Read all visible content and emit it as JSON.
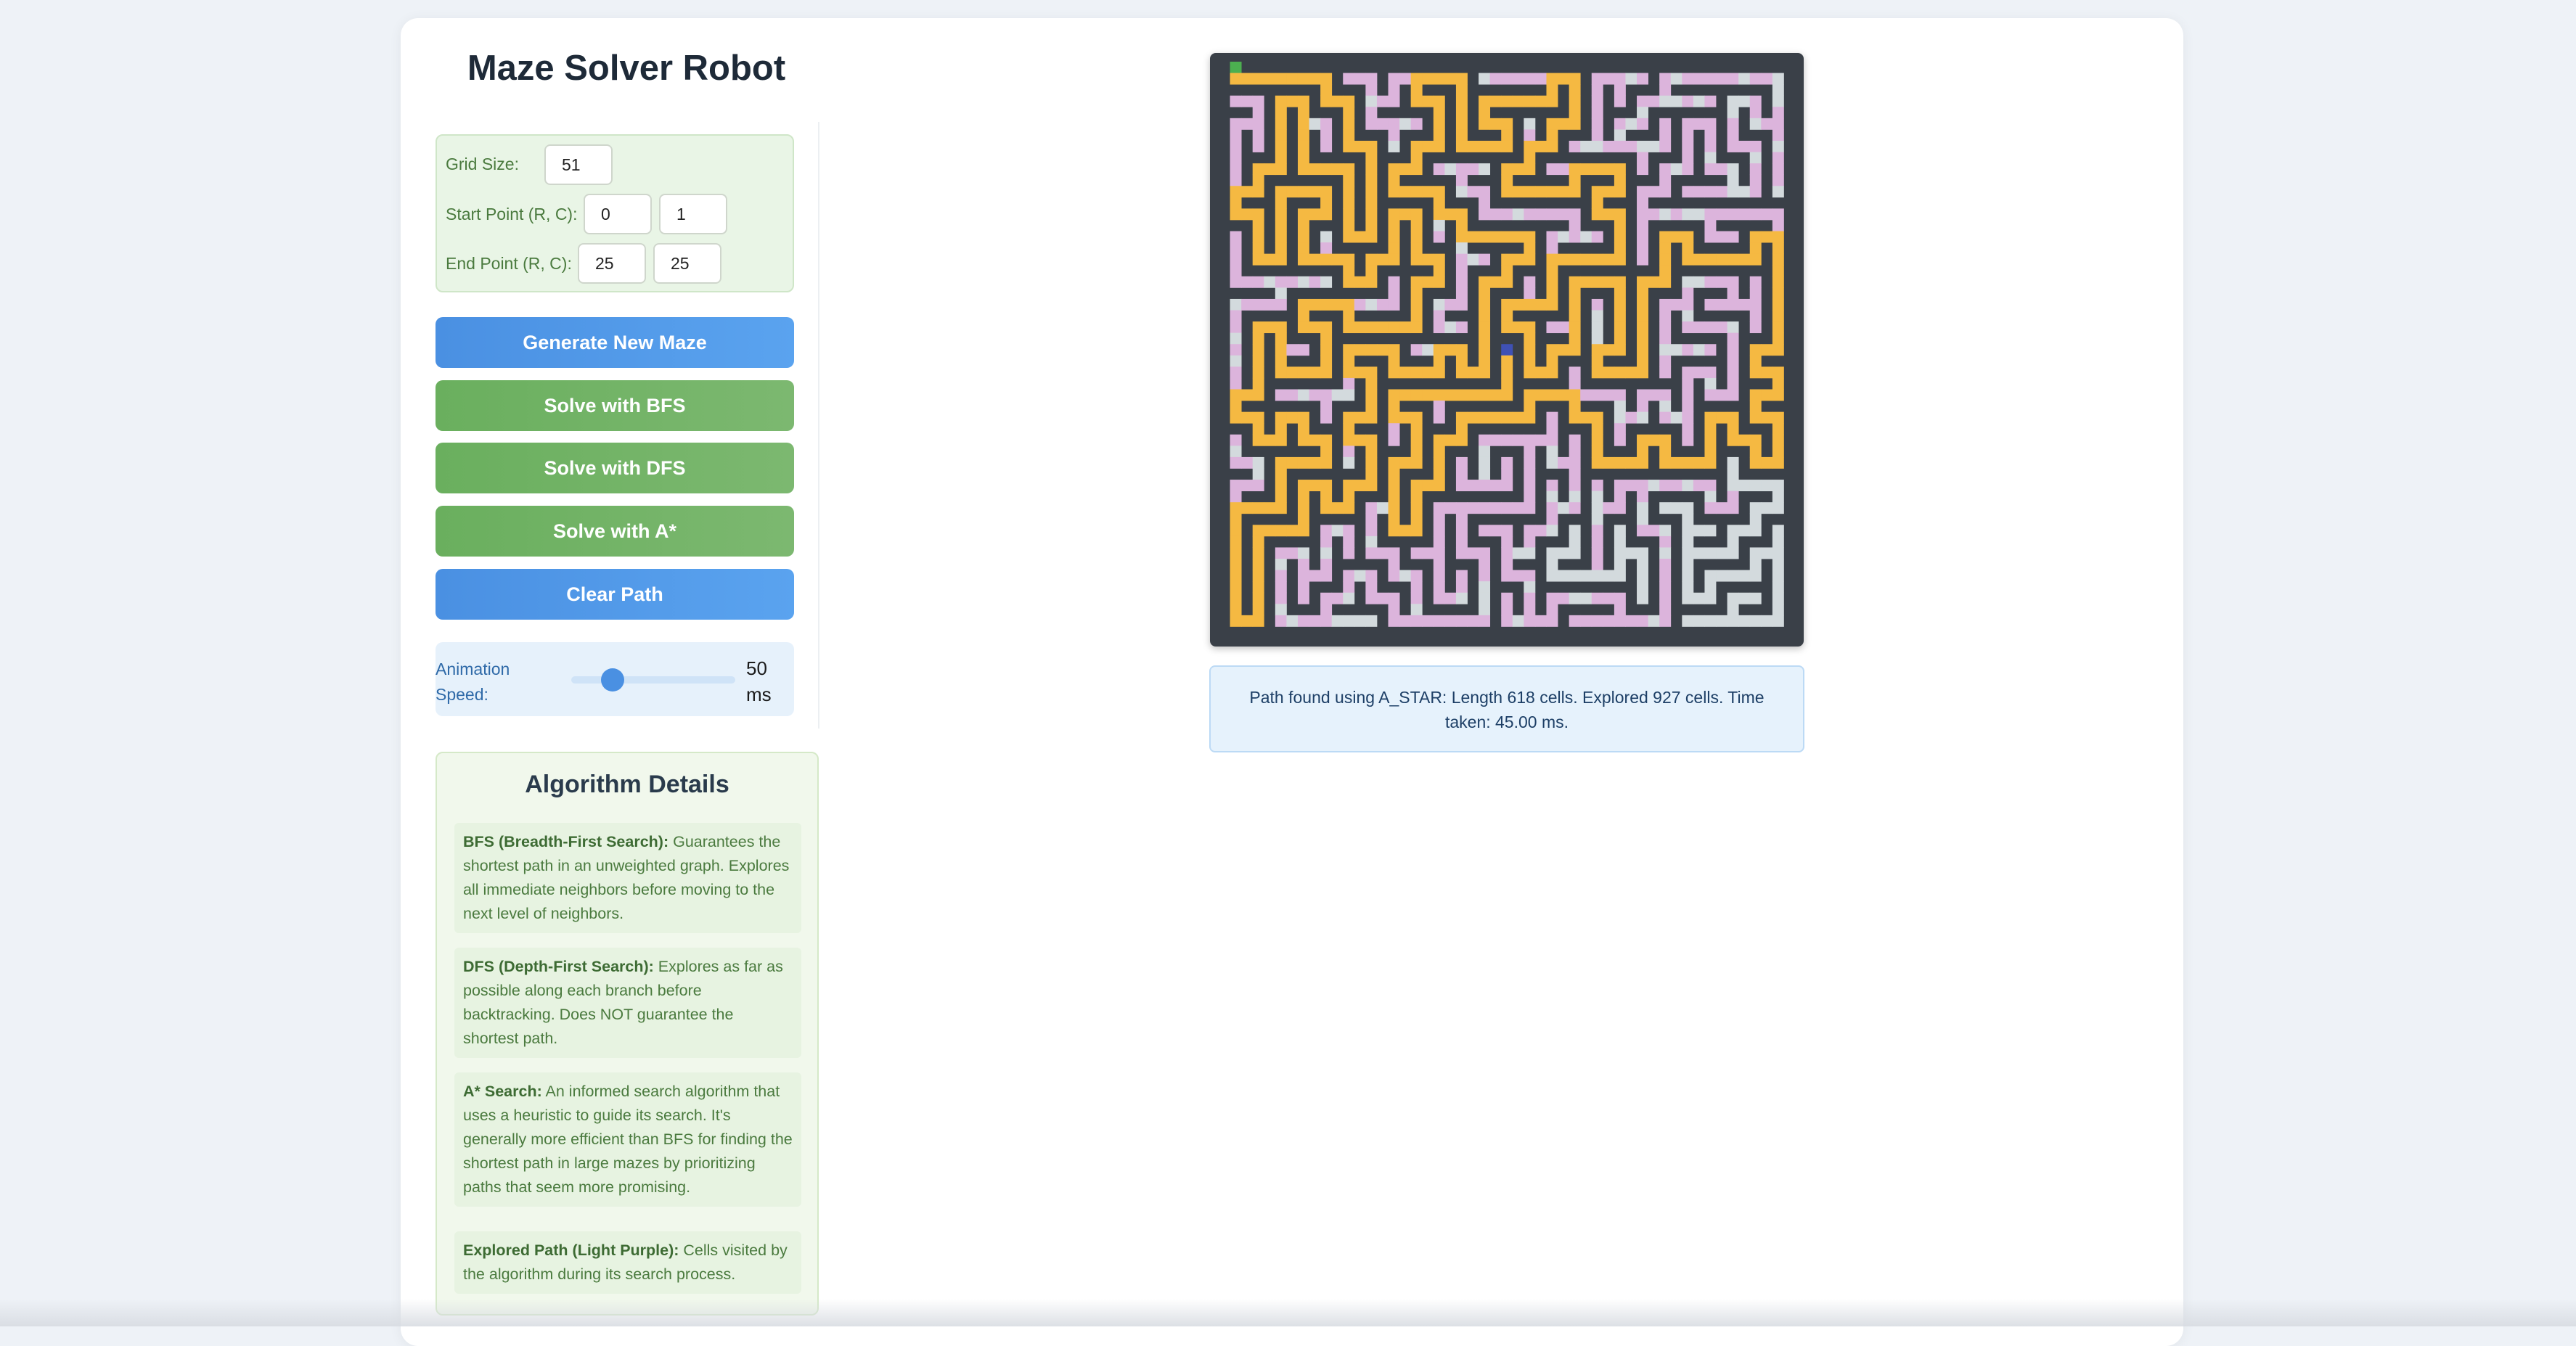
{
  "app": {
    "title": "Maze Solver Robot"
  },
  "inputs": {
    "grid_size_label": "Grid Size:",
    "grid_size_value": "51",
    "start_label": "Start Point (R, C):",
    "start_r": "0",
    "start_c": "1",
    "end_label": "End Point (R, C):",
    "end_r": "25",
    "end_c": "25"
  },
  "buttons": {
    "generate": "Generate New Maze",
    "bfs": "Solve with BFS",
    "dfs": "Solve with DFS",
    "astar": "Solve with A*",
    "clear": "Clear Path"
  },
  "speed": {
    "label": "Animation Speed:",
    "value": "50",
    "unit": "ms",
    "level_fraction": 0.25
  },
  "algorithm_details": {
    "title": "Algorithm Details",
    "items": [
      {
        "name": "BFS (Breadth-First Search):",
        "text": " Guarantees the shortest path in an unweighted graph. Explores all immediate neighbors before moving to the next level of neighbors."
      },
      {
        "name": "DFS (Depth-First Search):",
        "text": " Explores as far as possible along each branch before backtracking. Does NOT guarantee the shortest path."
      },
      {
        "name": "A* Search:",
        "text": " An informed search algorithm that uses a heuristic to guide its search. It's generally more efficient than BFS for finding the shortest path in large mazes by prioritizing paths that seem more promising."
      },
      {
        "name": "Explored Path (Light Purple):",
        "text": " Cells visited by the algorithm during its search process."
      }
    ]
  },
  "status": {
    "text": "Path found using A_STAR: Length 618 cells. Explored 927 cells. Time taken: 45.00 ms."
  },
  "maze_colors": {
    "wall": "#3a4048",
    "open": "#d3dadd",
    "explored": "#dcb4dc",
    "path": "#f5b942",
    "start": "#4caf50",
    "end": "#3f51b5"
  }
}
